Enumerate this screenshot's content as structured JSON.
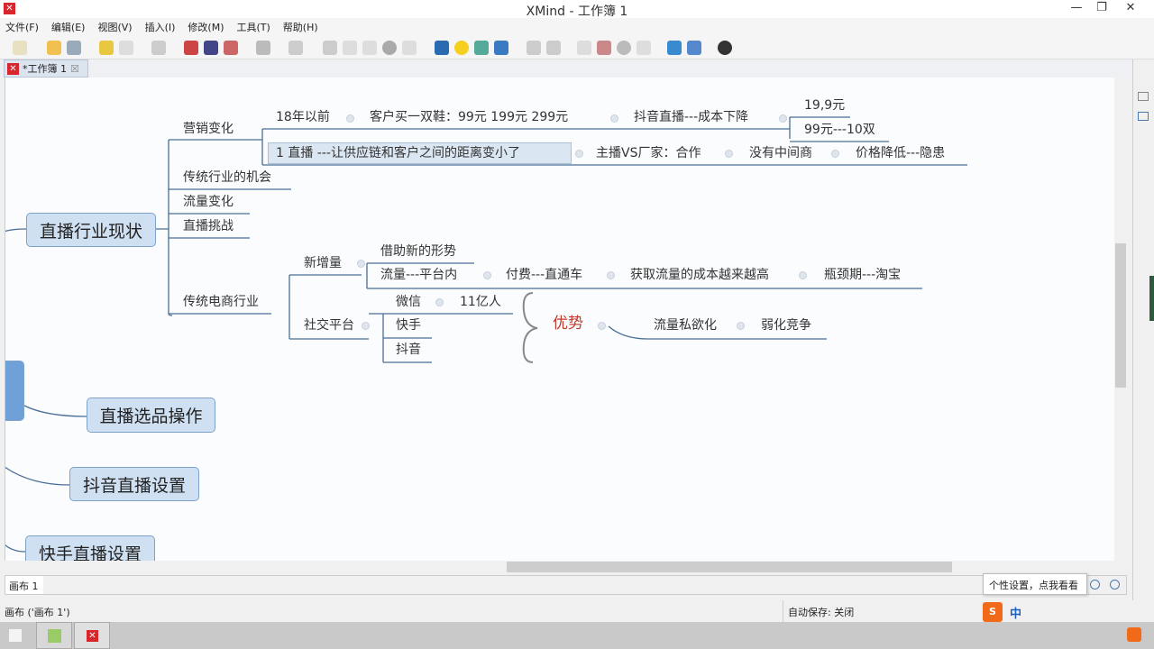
{
  "window": {
    "title": "XMind - 工作簿 1",
    "minimize": "—",
    "restore": "❐",
    "close": "✕"
  },
  "menu": [
    "文件(F)",
    "编辑(E)",
    "视图(V)",
    "插入(I)",
    "修改(M)",
    "工具(T)",
    "帮助(H)"
  ],
  "tab": {
    "label": "*工作簿 1",
    "close": "☒"
  },
  "map": {
    "central": [
      "直播行业现状",
      "直播选品操作",
      "抖音直播设置",
      "快手直播设置"
    ],
    "n": {
      "yingxiao": "营销变化",
      "y18": "18年以前",
      "kehu": "客户买一双鞋：99元  199元  299元",
      "douyin": "抖音直播---成本下降",
      "p199": "19,9元",
      "p99": "99元---10双",
      "zhibo": "1  直播 ---让供应链和客户之间的距离变小了",
      "zhubo": "主播VS厂家：合作",
      "meiyou": "没有中间商",
      "jiage": "价格降低---隐患",
      "chuantong": "传统行业的机会",
      "liuliang": "流量变化",
      "tiaozhan": "直播挑战",
      "dianshang": "传统电商行业",
      "xinzeng": "新增量",
      "jiezhu": "借助新的形势",
      "pingtai": "流量---平台内",
      "fufei": "付费---直通车",
      "huoqu": "获取流量的成本越来越高",
      "pingjing": "瓶颈期---淘宝",
      "shejiao": "社交平台",
      "weixin": "微信",
      "yi": "11亿人",
      "kuaishou": "快手",
      "dy": "抖音",
      "youshi": "优势",
      "siyu": "流量私欲化",
      "ruohua": "弱化竞争"
    }
  },
  "colors": {
    "accent": "#d9262c",
    "line": "#4a6e96",
    "advantage": "#c0392b"
  },
  "sheet": {
    "tab": "画布 1",
    "tooltip": "个性设置，点我看看"
  },
  "status": {
    "left": "画布 ('画布 1')",
    "autosave": "自动保存: 关闭"
  },
  "ime": {
    "lang": "中"
  }
}
